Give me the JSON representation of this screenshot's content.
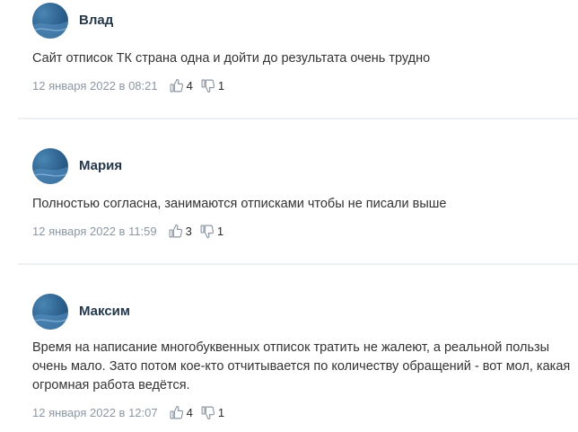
{
  "comments": [
    {
      "author": "Влад",
      "text": "Сайт отписок ТК страна одна и дойти до результата очень трудно",
      "date": "12 января 2022 в 08:21",
      "likes": "4",
      "dislikes": "1"
    },
    {
      "author": "Мария",
      "text": "Полностью согласна, занимаются отписками чтобы не писали выше",
      "date": "12 января 2022 в 11:59",
      "likes": "3",
      "dislikes": "1"
    },
    {
      "author": "Максим",
      "text": "Время на написание многобуквенных отписок тратить не жалеют, а реальной пользы очень мало. Зато потом кое-кто отчитывается по количеству обращений - вот мол, какая огромная работа ведётся.",
      "date": "12 января 2022 в 12:07",
      "likes": "4",
      "dislikes": "1"
    }
  ],
  "icons": {
    "like": "thumbs-up-icon",
    "dislike": "thumbs-down-icon"
  },
  "colors": {
    "date": "#8c97a3",
    "author": "#24384c",
    "avatar": "#2c5f8c"
  }
}
